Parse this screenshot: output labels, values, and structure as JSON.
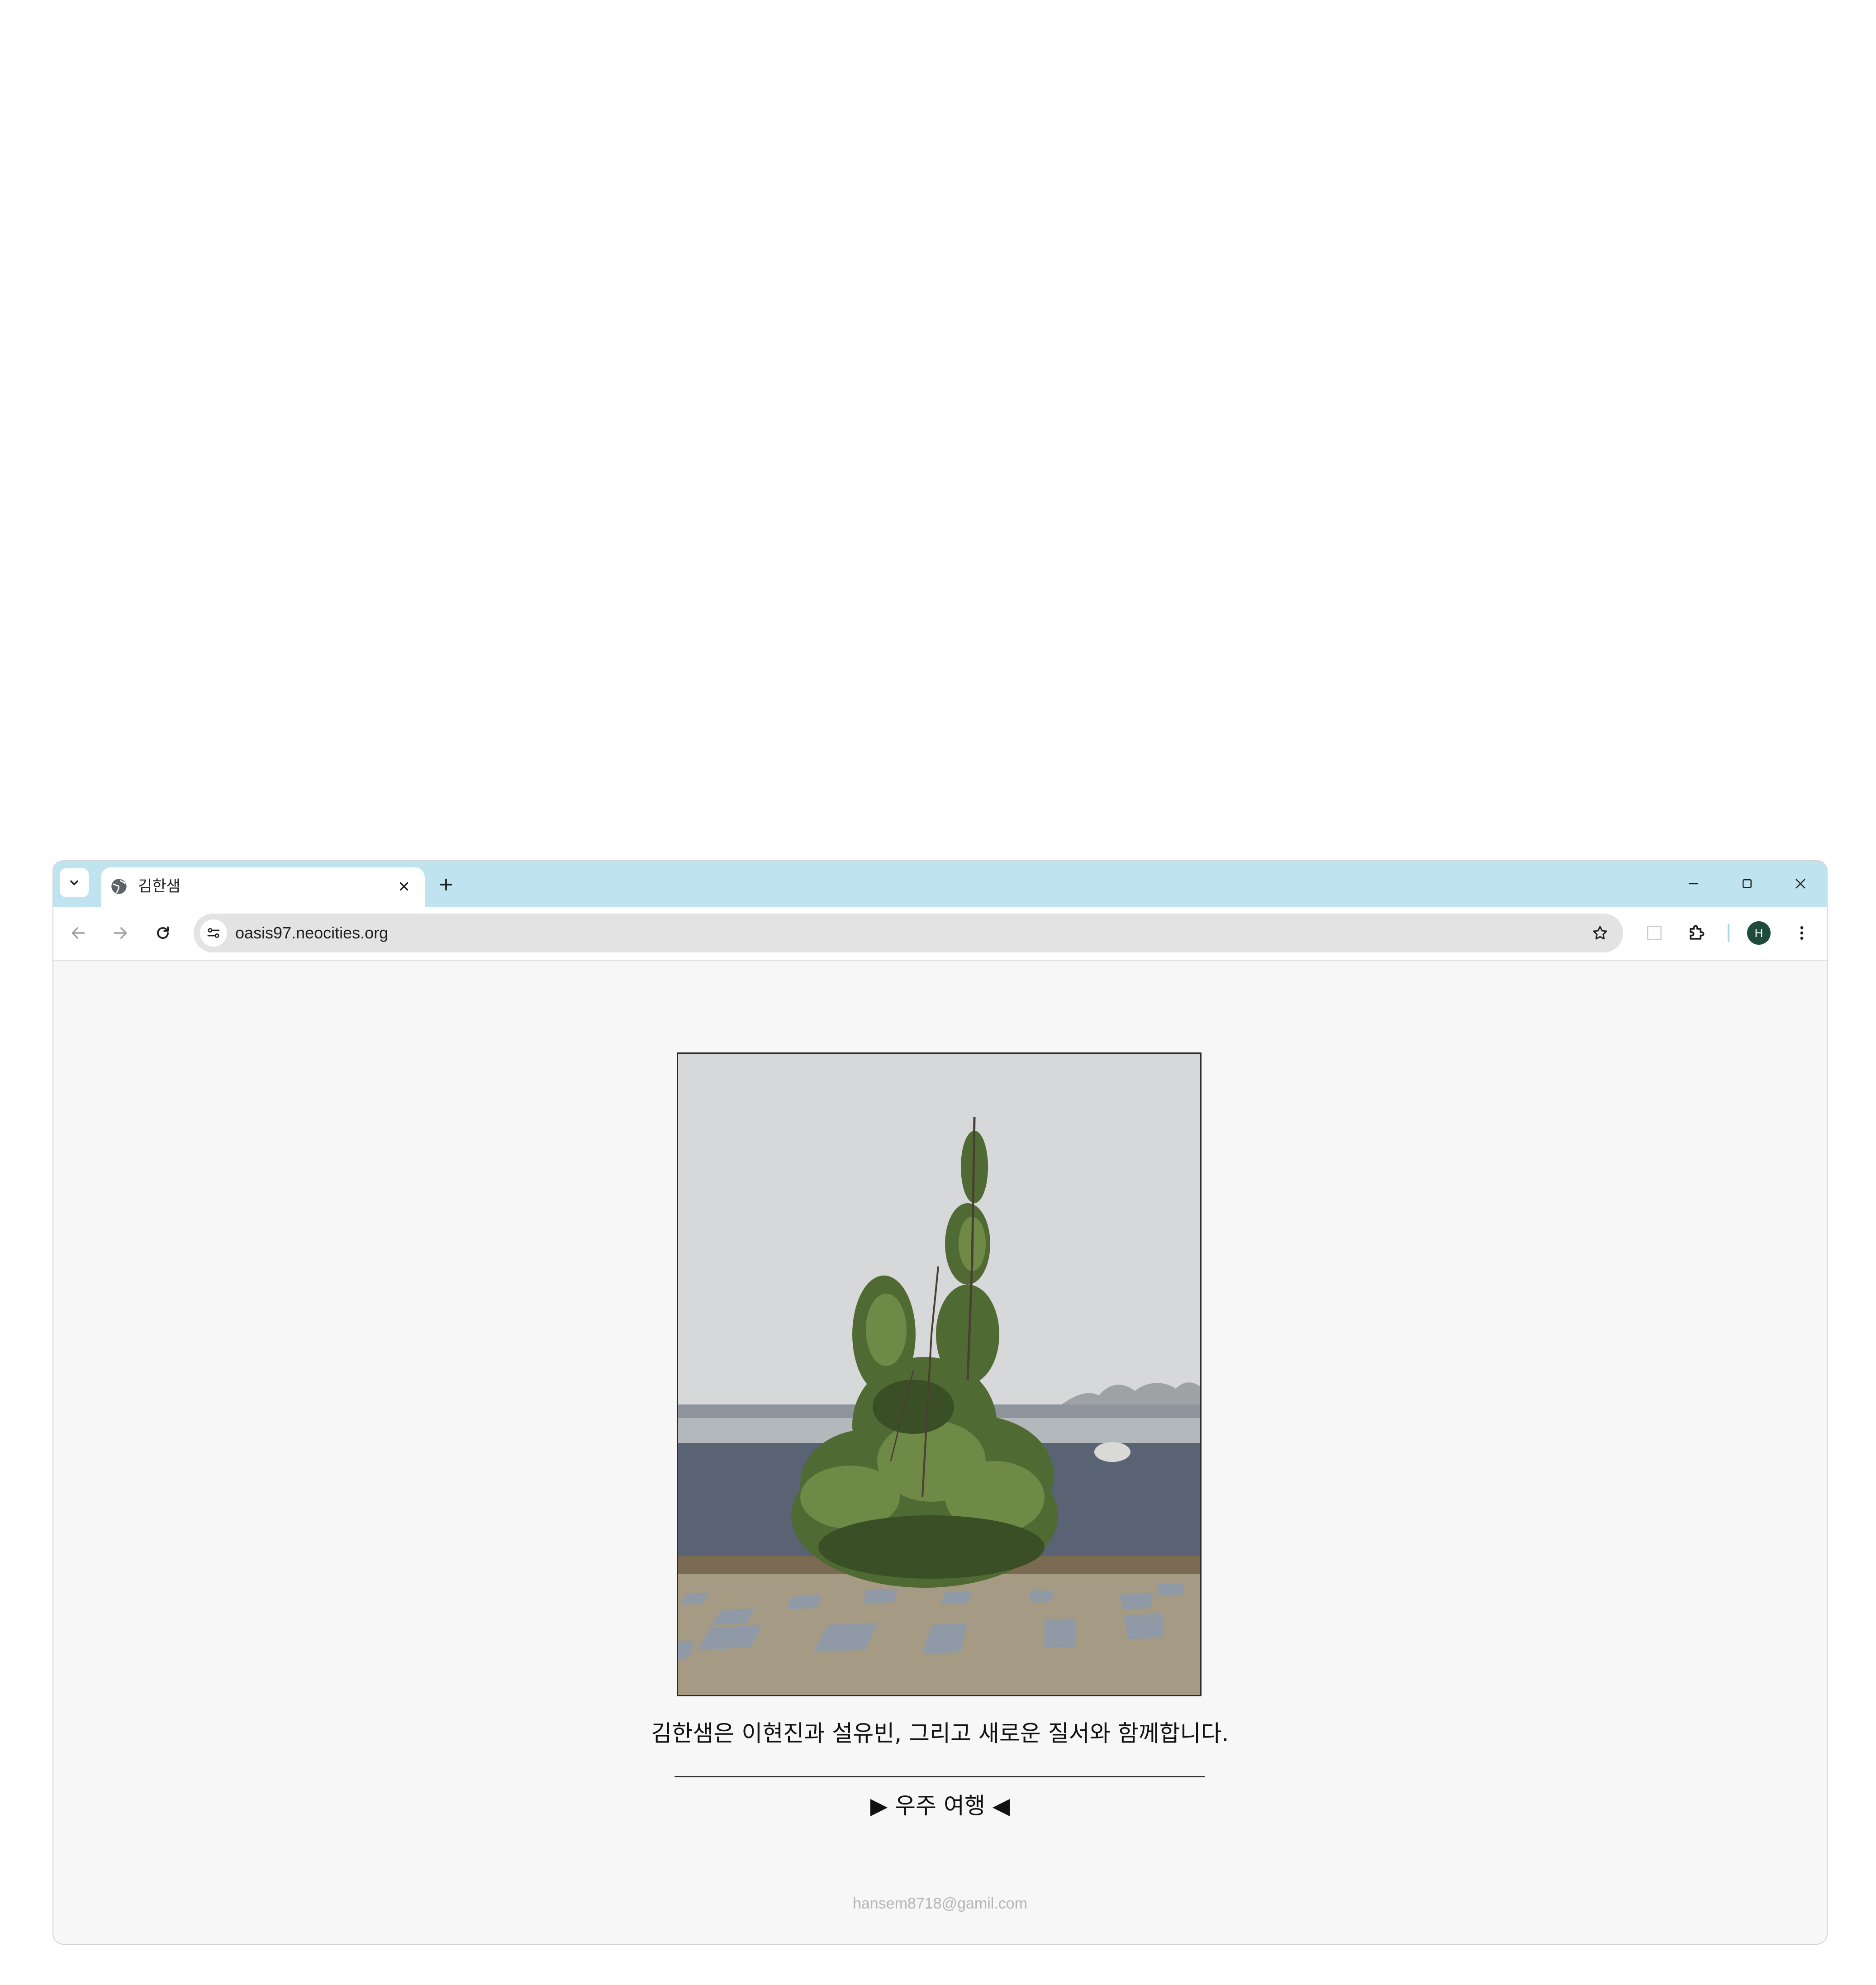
{
  "browser": {
    "tab": {
      "title": "김한샘",
      "favicon": "globe-icon"
    },
    "address_bar": {
      "url": "oasis97.neocities.org"
    },
    "profile_initial": "H",
    "colors": {
      "tabstrip": "#bfe4ef",
      "avatar": "#1f4b3d"
    }
  },
  "page": {
    "photo_alt": "쌍떡잎 관목 사진",
    "caption": "김한샘은 이현진과 설유빈, 그리고 새로운 질서와 함께합니다.",
    "link_label": "▶ 우주 여행 ◀",
    "email": "hansem8718@gamil.com"
  }
}
